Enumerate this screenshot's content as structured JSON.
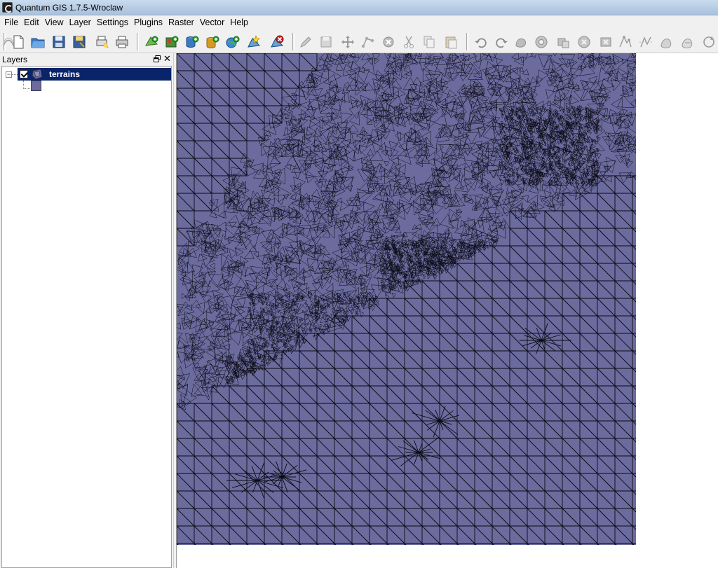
{
  "window": {
    "title": "Quantum GIS 1.7.5-Wroclaw"
  },
  "menu": [
    "File",
    "Edit",
    "View",
    "Layer",
    "Settings",
    "Plugins",
    "Raster",
    "Vector",
    "Help"
  ],
  "toolbar": [
    {
      "name": "new-project-icon",
      "interactable": true
    },
    {
      "name": "open-project-icon",
      "interactable": true
    },
    {
      "name": "save-project-icon",
      "interactable": true
    },
    {
      "name": "save-as-icon",
      "interactable": true
    },
    {
      "name": "new-print-composer-icon",
      "interactable": true
    },
    {
      "name": "print-icon",
      "interactable": true
    },
    {
      "name": "add-vector-layer-icon",
      "interactable": true
    },
    {
      "name": "add-raster-layer-icon",
      "interactable": true
    },
    {
      "name": "add-postgis-layer-icon",
      "interactable": true
    },
    {
      "name": "add-spatialite-layer-icon",
      "interactable": true
    },
    {
      "name": "add-wms-layer-icon",
      "interactable": true
    },
    {
      "name": "new-shapefile-layer-icon",
      "interactable": true
    },
    {
      "name": "remove-layer-icon",
      "interactable": true
    },
    {
      "name": "toggle-editing-icon",
      "interactable": false
    },
    {
      "name": "save-edits-icon",
      "interactable": false
    },
    {
      "name": "move-feature-icon",
      "interactable": false
    },
    {
      "name": "node-tool-icon",
      "interactable": false
    },
    {
      "name": "delete-selected-icon",
      "interactable": false
    },
    {
      "name": "cut-features-icon",
      "interactable": false
    },
    {
      "name": "copy-features-icon",
      "interactable": false
    },
    {
      "name": "paste-features-icon",
      "interactable": false
    },
    {
      "name": "undo-icon",
      "interactable": false
    },
    {
      "name": "redo-icon",
      "interactable": false
    },
    {
      "name": "simplify-feature-icon",
      "interactable": false
    },
    {
      "name": "add-ring-icon",
      "interactable": false
    },
    {
      "name": "add-part-icon",
      "interactable": false
    },
    {
      "name": "delete-ring-icon",
      "interactable": false
    },
    {
      "name": "delete-part-icon",
      "interactable": false
    },
    {
      "name": "reshape-features-icon",
      "interactable": false
    },
    {
      "name": "split-features-icon",
      "interactable": false
    },
    {
      "name": "merge-features-icon",
      "interactable": false
    },
    {
      "name": "merge-attributes-icon",
      "interactable": false
    },
    {
      "name": "rotate-point-symbols-icon",
      "interactable": false
    },
    {
      "name": "offset-curve-icon",
      "interactable": false
    }
  ],
  "layers_panel": {
    "title": "Layers",
    "layers": [
      {
        "name": "terrains",
        "checked": true,
        "selected": true
      }
    ]
  },
  "map": {
    "fill_color": "#6b6b9e",
    "edge_color": "#0a0a14"
  },
  "colors": {
    "selection": "#0a246a",
    "chrome": "#f0f0f0"
  }
}
